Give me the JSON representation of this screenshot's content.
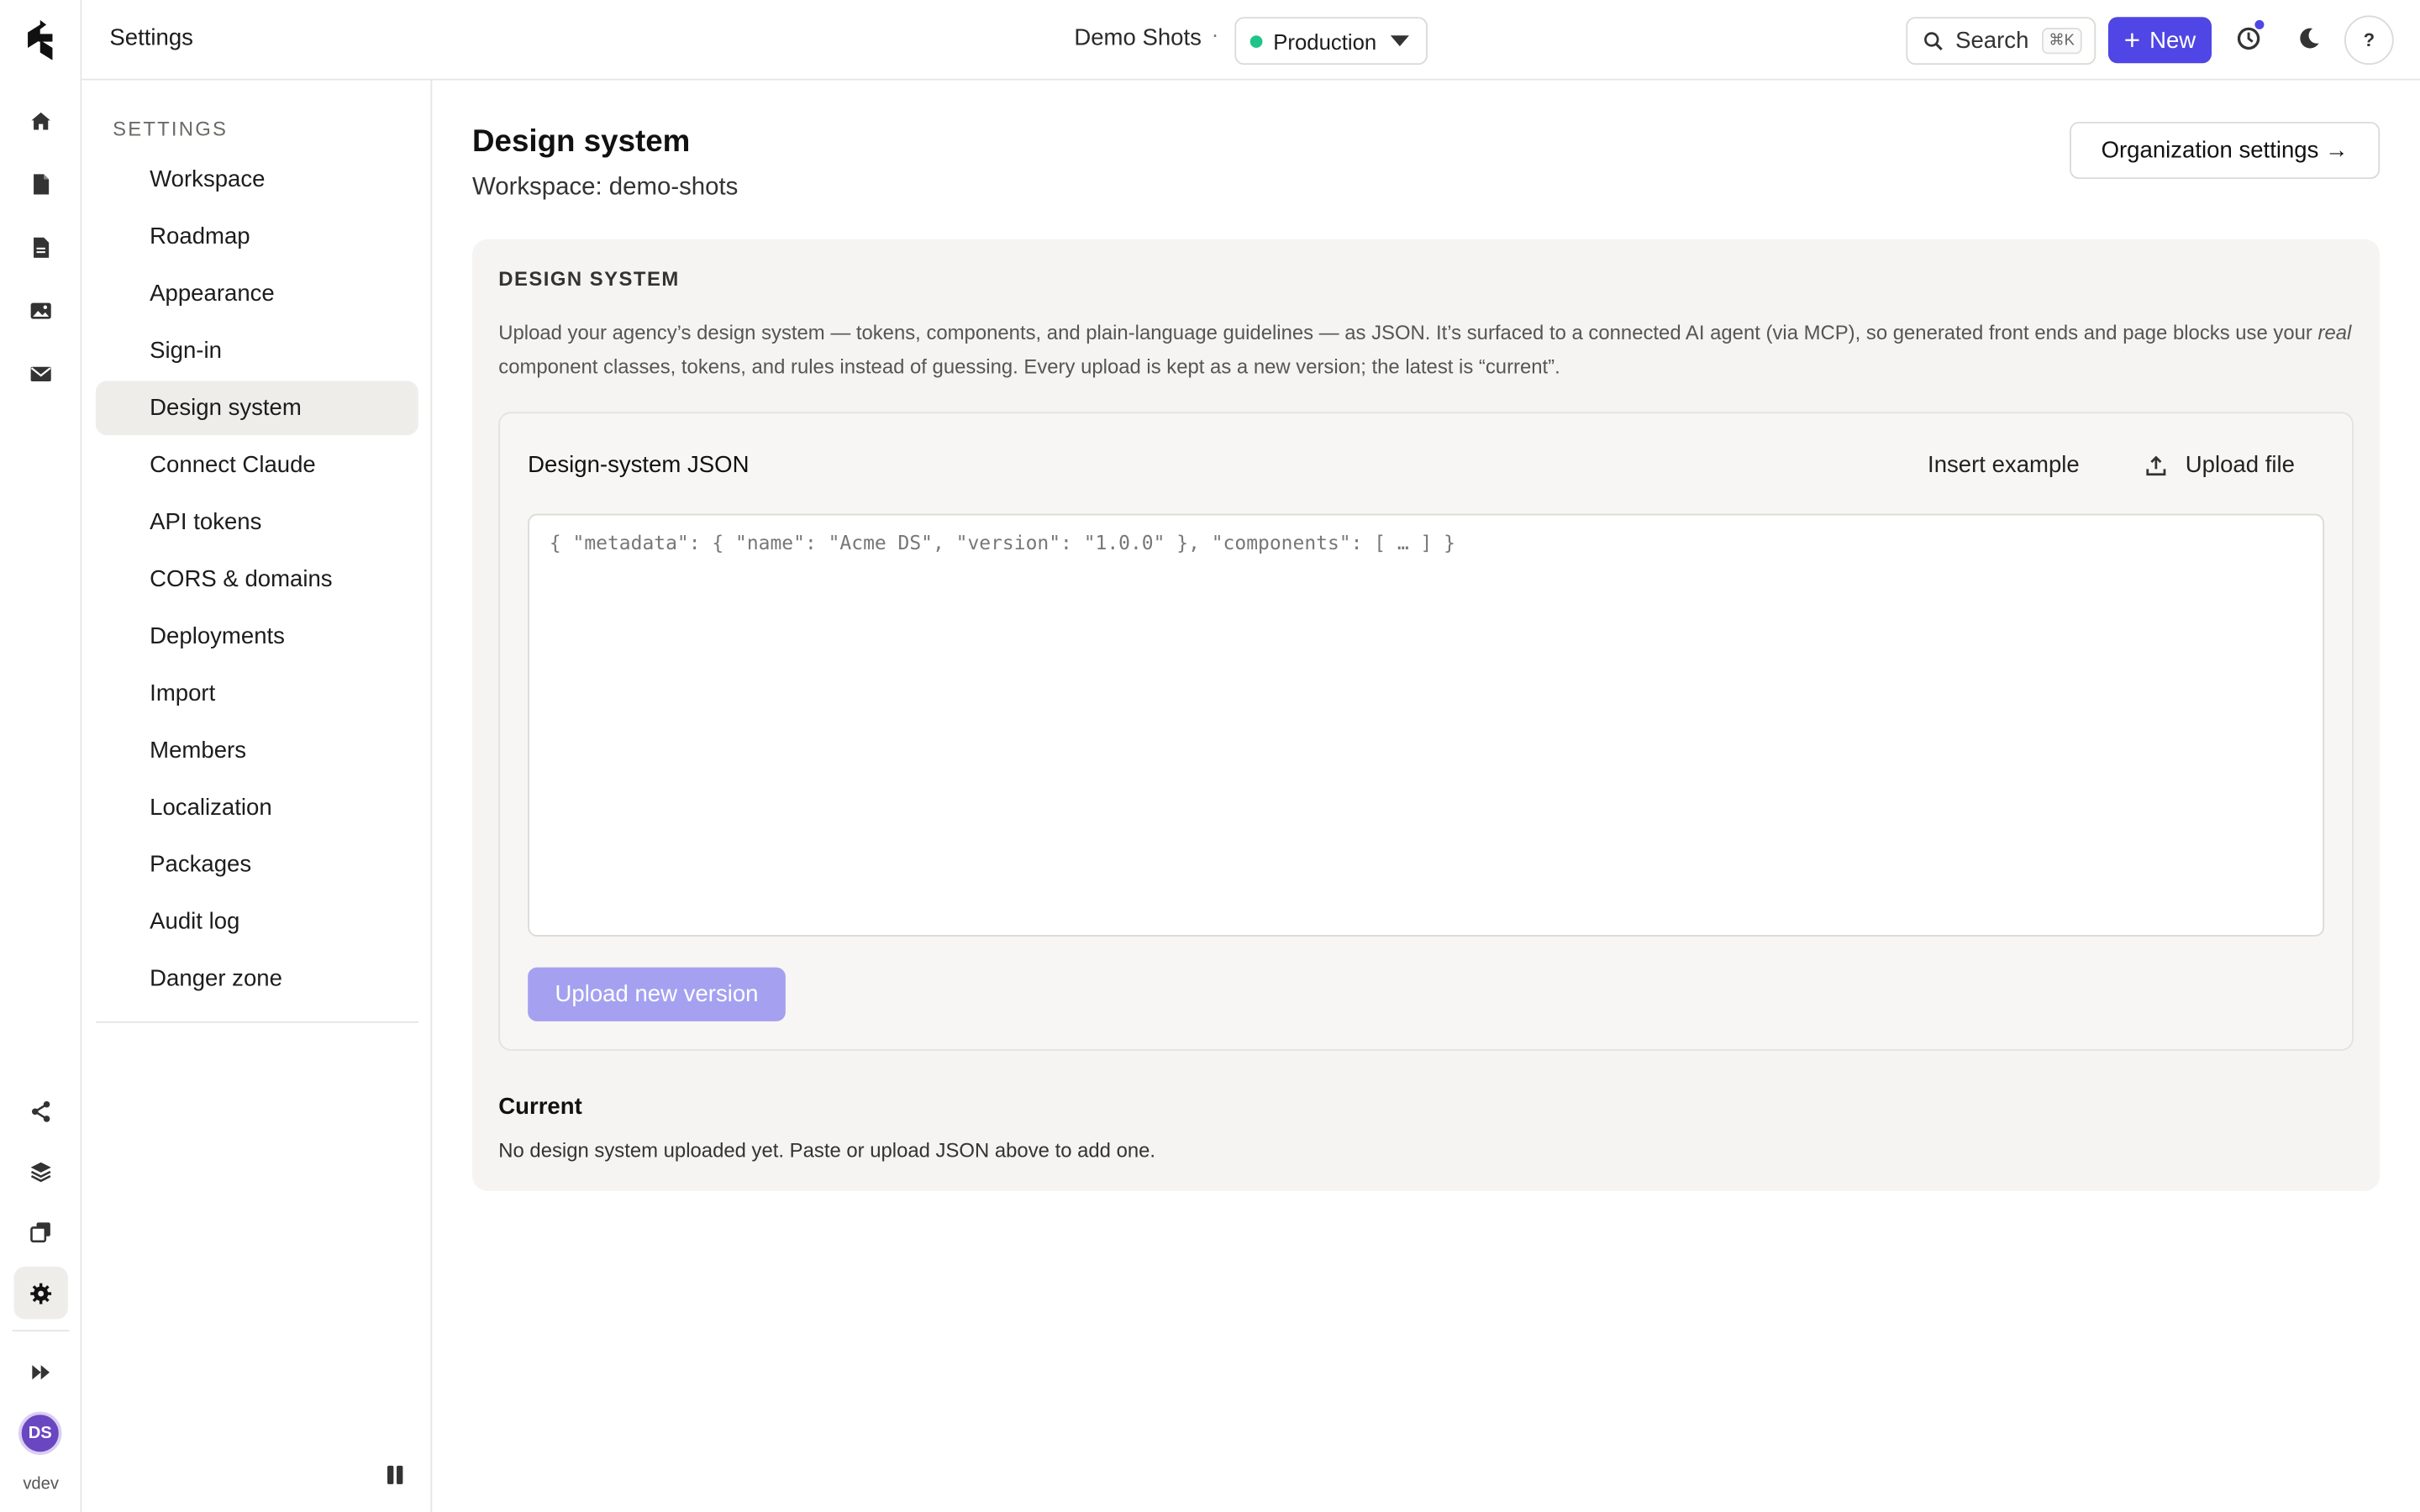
{
  "header": {
    "title": "Settings",
    "project": "Demo Shots",
    "separator": "·",
    "environment": "Production",
    "search_label": "Search",
    "search_shortcut": "⌘K",
    "new_label": "New",
    "help_label": "?"
  },
  "rail": {
    "avatar_initials": "DS",
    "user_label": "vdev"
  },
  "settings_nav": {
    "heading": "SETTINGS",
    "items": [
      {
        "label": "Workspace"
      },
      {
        "label": "Roadmap"
      },
      {
        "label": "Appearance"
      },
      {
        "label": "Sign-in"
      },
      {
        "label": "Design system"
      },
      {
        "label": "Connect Claude"
      },
      {
        "label": "API tokens"
      },
      {
        "label": "CORS & domains"
      },
      {
        "label": "Deployments"
      },
      {
        "label": "Import"
      },
      {
        "label": "Members"
      },
      {
        "label": "Localization"
      },
      {
        "label": "Packages"
      },
      {
        "label": "Audit log"
      },
      {
        "label": "Danger zone"
      }
    ],
    "active": "Design system"
  },
  "page": {
    "title": "Design system",
    "subtitle": "Workspace: demo-shots",
    "org_button": "Organization settings →"
  },
  "card": {
    "title": "DESIGN SYSTEM",
    "description_part1": "Upload your agency’s design system — tokens, components, and plain-language guidelines — as JSON. It’s surfaced to a connected AI agent (via MCP), so generated front ends and page blocks use your ",
    "description_em": "real",
    "description_part2": " component classes, tokens, and rules instead of guessing. Every upload is kept as a new version; the latest is “current”.",
    "json_title": "Design-system JSON",
    "insert_example": "Insert example",
    "upload_file": "Upload file",
    "textarea_placeholder": "{ \"metadata\": { \"name\": \"Acme DS\", \"version\": \"1.0.0\" }, \"components\": [ … ] }",
    "textarea_value": "",
    "upload_button": "Upload new version",
    "current_heading": "Current",
    "current_text": "No design system uploaded yet. Paste or upload JSON above to add one."
  },
  "colors": {
    "accent": "#4f46e5",
    "accent_disabled": "#a5a1f0",
    "env_status": "#1fc48a",
    "avatar": "#6b46c1"
  }
}
